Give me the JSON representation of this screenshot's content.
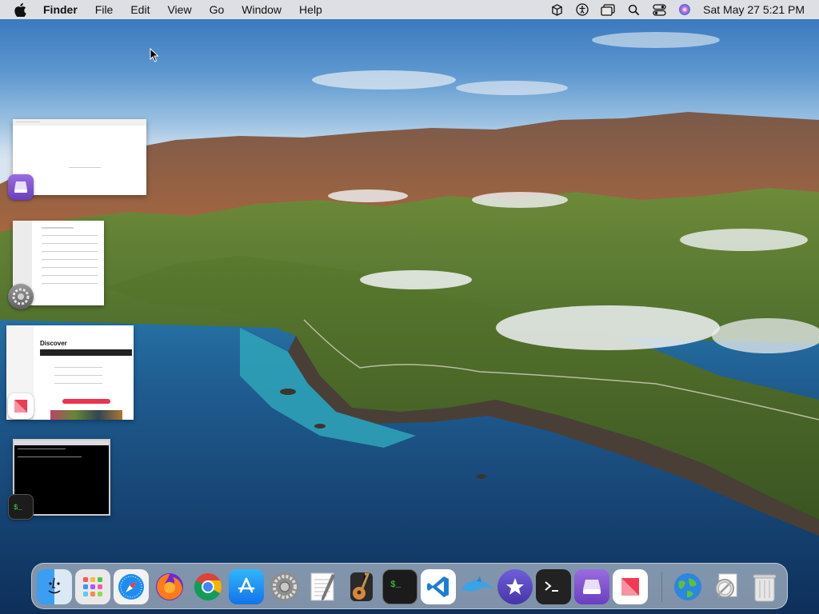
{
  "menubar": {
    "app_name": "Finder",
    "items": [
      "File",
      "Edit",
      "View",
      "Go",
      "Window",
      "Help"
    ],
    "clock": "Sat May 27  5:21 PM"
  },
  "thumbnails": [
    {
      "app": "purple-archive-icon"
    },
    {
      "app": "gear-icon"
    },
    {
      "app": "news-icon"
    },
    {
      "app": "terminal-icon"
    }
  ],
  "news_thumb": {
    "title": "Discover"
  },
  "dock": {
    "apps": [
      "Finder",
      "Launchpad",
      "Safari",
      "Firefox",
      "Chrome",
      "App Store",
      "System Preferences",
      "TextEdit",
      "GarageBand",
      "Terminal",
      "Visual Studio Code",
      "Dolphin",
      "iMovie",
      "Script Editor",
      "Archive Utility",
      "News"
    ],
    "right_apps": [
      "Network Radar",
      "Preview",
      "Trash"
    ]
  }
}
